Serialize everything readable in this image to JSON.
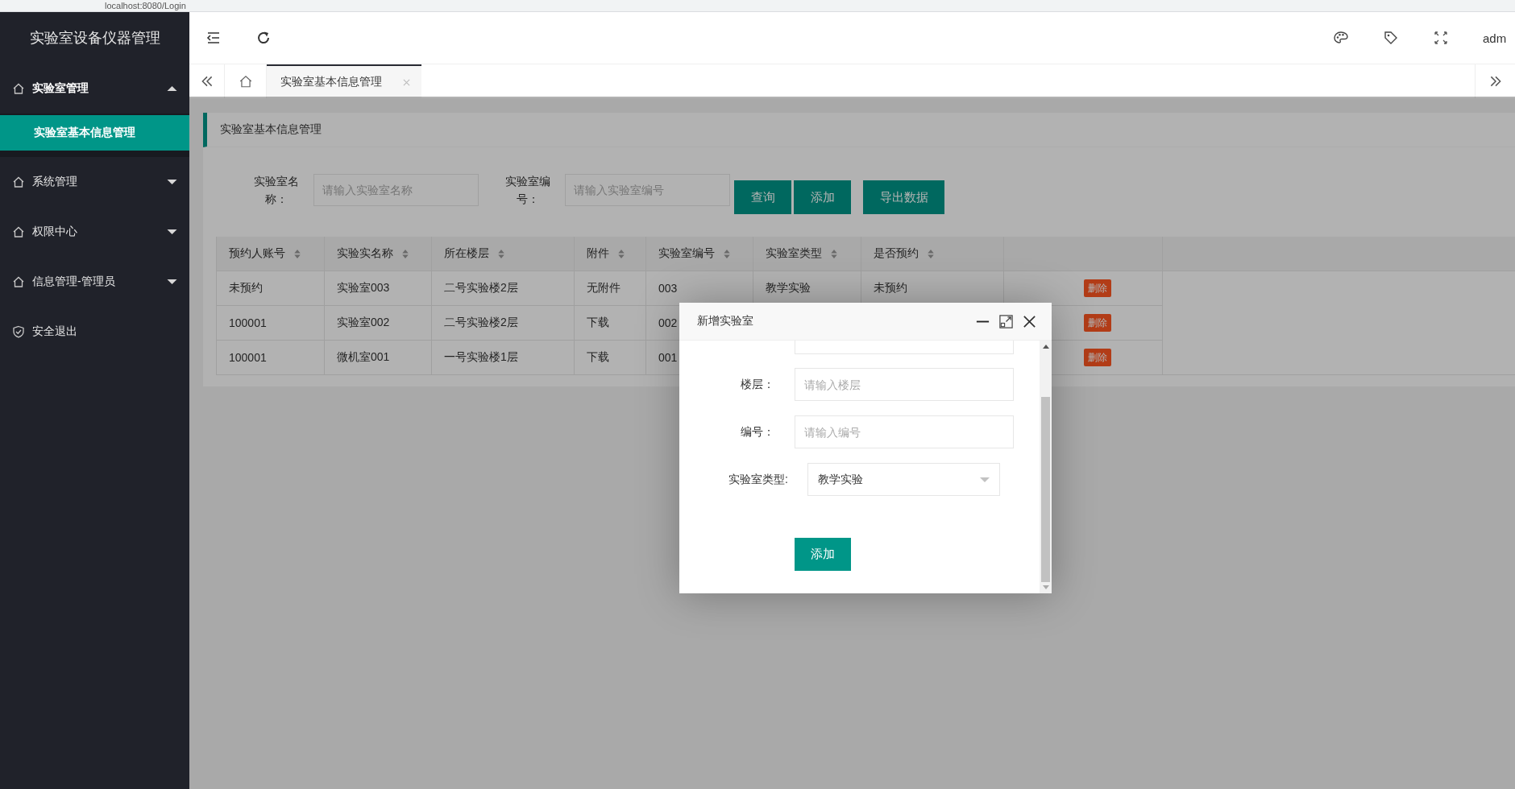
{
  "browser": {
    "url": "localhost:8080/Login"
  },
  "app_title": "实验室设备仪器管理",
  "sidebar": {
    "items": [
      {
        "kind": "group",
        "label": "实验室管理",
        "expanded": true,
        "children": [
          {
            "label": "实验室基本信息管理",
            "selected": true
          }
        ]
      },
      {
        "kind": "group",
        "label": "系统管理",
        "expanded": false
      },
      {
        "kind": "group",
        "label": "权限中心",
        "expanded": false
      },
      {
        "kind": "group",
        "label": "信息管理-管理员",
        "expanded": false
      },
      {
        "kind": "link",
        "label": "安全退出"
      }
    ]
  },
  "header": {
    "user": "adm"
  },
  "tabs": [
    {
      "label": "实验室基本信息管理",
      "selected": true
    }
  ],
  "page": {
    "title": "实验室基本信息管理",
    "filters": [
      {
        "label": "实验室名称：",
        "placeholder": "请输入实验室名称"
      },
      {
        "label": "实验室编号：",
        "placeholder": "请输入实验室编号"
      }
    ],
    "buttons": [
      "查询",
      "添加",
      "导出数据"
    ]
  },
  "table": {
    "columns": [
      "预约人账号",
      "实验实名称",
      "所在楼层",
      "附件",
      "实验室编号",
      "实验室类型",
      "是否预约"
    ],
    "rows": [
      {
        "cells": [
          "未预约",
          "实验室003",
          "二号实验楼2层",
          "无附件",
          "003",
          "教学实验",
          "未预约"
        ],
        "action": "删除"
      },
      {
        "cells": [
          "100001",
          "实验室002",
          "二号实验楼2层",
          "下载",
          "002"
        ],
        "action": "删除"
      },
      {
        "cells": [
          "100001",
          "微机室001",
          "一号实验楼1层",
          "下载",
          "001"
        ],
        "action": "删除"
      }
    ]
  },
  "dialog": {
    "title": "新增实验室",
    "fields": [
      {
        "kind": "input",
        "label": "楼层：",
        "placeholder": "请输入楼层"
      },
      {
        "kind": "input",
        "label": "编号：",
        "placeholder": "请输入编号"
      },
      {
        "kind": "select",
        "label": "实验室类型:",
        "value": "教学实验"
      }
    ],
    "submit": "添加"
  }
}
